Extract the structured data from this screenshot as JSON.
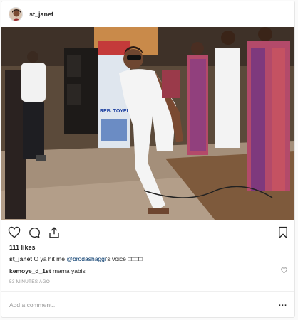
{
  "post": {
    "username": "st_janet",
    "likes_text": "111 likes",
    "caption": {
      "username": "st_janet",
      "text_before": "O ya hit me",
      "mention": "@brodashaggi",
      "text_after": "'s voice □□□□"
    },
    "comments": [
      {
        "username": "kemoye_d_1st",
        "text": "mama yabis"
      }
    ],
    "timestamp": "53 MINUTES AGO",
    "add_comment_placeholder": "Add a comment...",
    "more_label": "..."
  },
  "icons": {
    "like": "heart-icon",
    "comment": "comment-icon",
    "share": "share-icon",
    "save": "bookmark-icon",
    "comment_like": "small-heart-icon",
    "more": "more-options-icon"
  },
  "photo": {
    "description_hidden": "",
    "banner_text": "REB. TOYEBE"
  },
  "colors": {
    "mention": "#003569",
    "muted": "#999999",
    "text": "#262626",
    "border": "#e6e6e6"
  }
}
